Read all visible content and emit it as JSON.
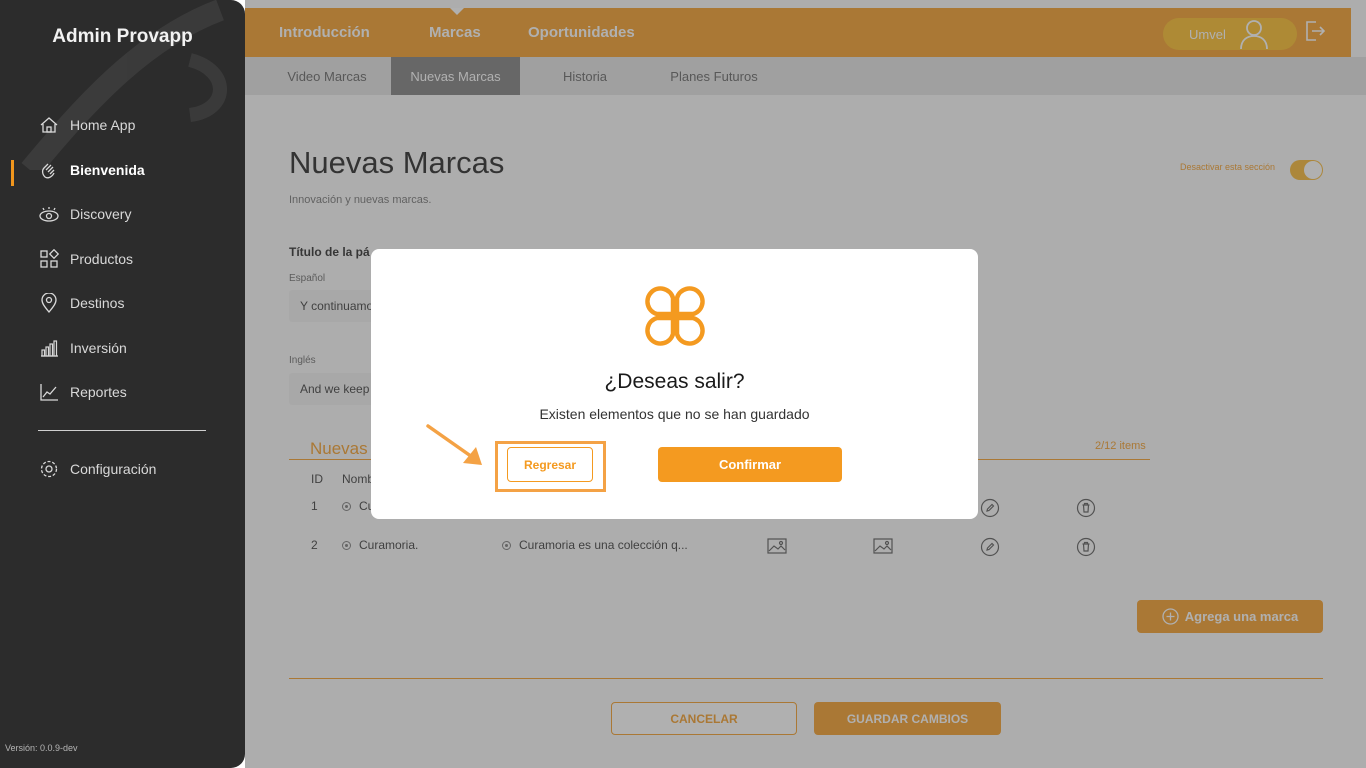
{
  "app": {
    "title": "Admin Provapp",
    "version": "Versión: 0.0.9-dev"
  },
  "sidebar": {
    "items": [
      {
        "label": "Home App",
        "icon": "home-icon"
      },
      {
        "label": "Bienvenida",
        "icon": "wave-hand-icon",
        "active": true
      },
      {
        "label": "Discovery",
        "icon": "eye-icon"
      },
      {
        "label": "Productos",
        "icon": "grid-icon"
      },
      {
        "label": "Destinos",
        "icon": "location-pin-icon"
      },
      {
        "label": "Inversión",
        "icon": "bar-chart-icon"
      },
      {
        "label": "Reportes",
        "icon": "line-chart-icon"
      }
    ],
    "settings": {
      "label": "Configuración",
      "icon": "gear-icon"
    }
  },
  "topbar": {
    "tabs": [
      "Introducción",
      "Marcas",
      "Oportunidades"
    ],
    "active_tab": "Marcas",
    "user": "Umvel"
  },
  "subtabs": {
    "items": [
      "Video Marcas",
      "Nuevas Marcas",
      "Historia",
      "Planes Futuros"
    ],
    "active": "Nuevas Marcas"
  },
  "page": {
    "title": "Nuevas Marcas",
    "subtitle": "Innovación y nuevas marcas.",
    "toggle_label": "Desactivar esta sección",
    "toggle_on": true,
    "field_title": "Título de la pá",
    "spanish_label": "Español",
    "spanish_value": "Y continuamo",
    "english_label": "Inglés",
    "english_value": "And we keep",
    "section_title": "Nuevas",
    "count": "2/12 items"
  },
  "table": {
    "headers": [
      "ID",
      "Nomb"
    ],
    "rows": [
      {
        "id": "1",
        "name": "Cu",
        "desc": ""
      },
      {
        "id": "2",
        "name": "Curamoria.",
        "desc": "Curamoria es una colección q..."
      }
    ]
  },
  "buttons": {
    "add_brand": "Agrega una marca",
    "cancel": "CANCELAR",
    "save": "GUARDAR CAMBIOS"
  },
  "modal": {
    "title": "¿Deseas salir?",
    "message": "Existen elementos que no se han guardado",
    "back": "Regresar",
    "confirm": "Confirmar"
  },
  "colors": {
    "accent": "#f49a20",
    "sidebar": "#2c2c2c"
  }
}
